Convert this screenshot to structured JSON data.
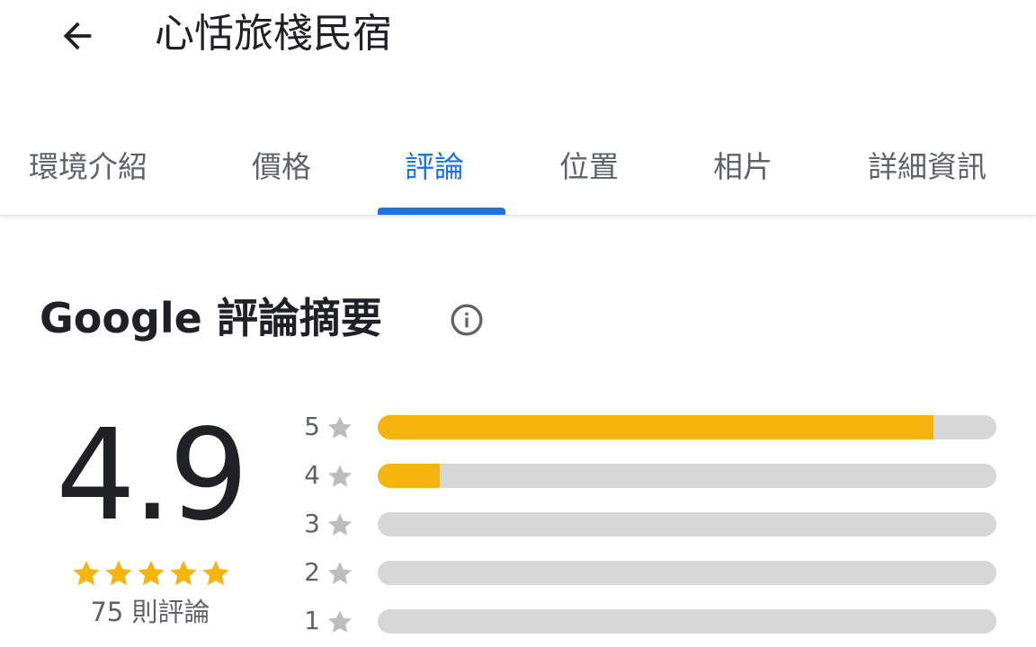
{
  "header": {
    "title": "心恬旅棧民宿",
    "back_icon": "arrow-left-icon"
  },
  "tabs": [
    {
      "label": "環境介紹",
      "active": false
    },
    {
      "label": "價格",
      "active": false
    },
    {
      "label": "評論",
      "active": true
    },
    {
      "label": "位置",
      "active": false
    },
    {
      "label": "相片",
      "active": false
    },
    {
      "label": "詳細資訊",
      "active": false
    }
  ],
  "summary": {
    "title": "Google 評論摘要",
    "info_icon": "info-circle-icon",
    "rating": "4.9",
    "stars_filled": 5,
    "stars_total": 5,
    "review_count": "75 則評論",
    "histogram": [
      {
        "label": "5",
        "fraction": 0.898
      },
      {
        "label": "4",
        "fraction": 0.1
      },
      {
        "label": "3",
        "fraction": 0.0
      },
      {
        "label": "2",
        "fraction": 0.0
      },
      {
        "label": "1",
        "fraction": 0.0
      }
    ]
  },
  "colors": {
    "accent": "#1a73e8",
    "star": "#f6b40e",
    "bar_track": "#d7d7d7",
    "muted_text": "#5f6368",
    "muted_star": "#bdbdbd"
  }
}
